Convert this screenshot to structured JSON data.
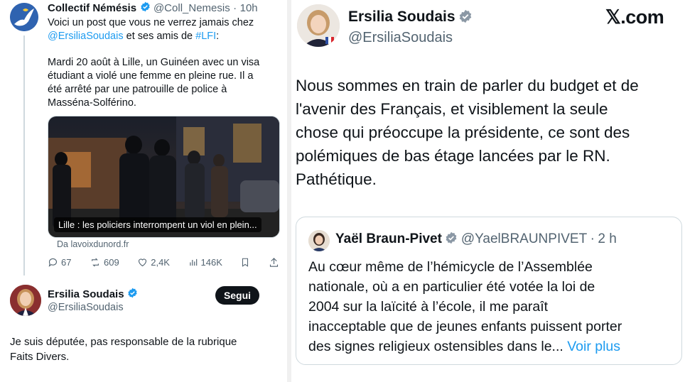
{
  "left": {
    "tweet1": {
      "author_name": "Collectif Némésis",
      "author_handle": "@Coll_Nemesis",
      "time_sep": "·",
      "time": "10h",
      "line1": "Voici un post que vous ne verrez jamais chez",
      "mention": "@ErsiliaSoudais",
      "line2_mid": " et ses amis de ",
      "hashtag": "#LFI",
      "line2_end": ":",
      "paragraph": [
        "Mardi 20 août à Lille, un Guinéen avec un visa",
        "étudiant a violé une femme en pleine rue. Il a",
        "été  arrêté par une patrouille de police à",
        "Masséna-Solférino."
      ],
      "media_caption": "Lille : les policiers interrompent un viol en plein...",
      "source": "Da lavoixdunord.fr",
      "metrics": {
        "replies": "67",
        "reposts": "609",
        "likes": "2,4K",
        "views": "146K"
      }
    },
    "tweet2": {
      "author_name": "Ersilia Soudais",
      "author_handle": "@ErsiliaSoudais",
      "follow_label": "Segui",
      "text_lines": [
        "Je suis députée, pas responsable de la rubrique",
        "Faits Divers."
      ]
    }
  },
  "right": {
    "logo": "𝕏.com",
    "author_name": "Ersilia Soudais",
    "author_handle": "@ErsiliaSoudais",
    "text_lines": [
      "Nous sommes en train de parler du budget et de",
      "l'avenir des Français, et visiblement la seule",
      "chose qui préoccupe la présidente, ce sont des",
      "polémiques de bas étage lancées par le RN.",
      "Pathétique."
    ],
    "quote": {
      "author_name": "Yaël Braun-Pivet",
      "author_handle": "@YaelBRAUNPIVET",
      "time_sep": "·",
      "time": "2 h",
      "text_lines": [
        "Au cœur même de l’hémicycle de l’Assemblée",
        "nationale, où a en particulier été votée la loi de",
        "2004 sur la laïcité à l’école, il me paraît",
        "inacceptable que de jeunes enfants puissent porter"
      ],
      "last_line": "des signes religieux ostensibles dans le...",
      "more_label": "Voir plus"
    }
  },
  "colors": {
    "accent": "#1d9bf0",
    "text": "#0f1419",
    "muted": "#536471",
    "border": "#cfd9de"
  }
}
